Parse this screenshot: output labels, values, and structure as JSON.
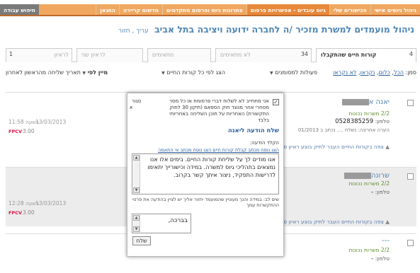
{
  "nav": {
    "tabs": [
      "ניהול גיוסים אישי",
      "הכישורים שלי",
      "גיוס עובדים - אפשרויות פרסום",
      "פתרונות גיוס ופרסום מתקדמים",
      "מדשום קריירה",
      "התגאן"
    ],
    "search_tab": "חיפוש עבודה"
  },
  "page": {
    "title": "ניהול מועמדים למשרת מזכיר /ה לחברה ידועה ויציבה בתל אביב",
    "edit_links": "עריך , חזור"
  },
  "filters": {
    "tabs": [
      {
        "count": "4",
        "label": "קורות חיים שהתקבלו",
        "active": true
      },
      {
        "count": "34",
        "label": "לא מתאימים"
      },
      {
        "count": "",
        "label": "מתאימים"
      },
      {
        "count": "",
        "label": "לראיון שני"
      },
      {
        "count": "1",
        "label": "לראיון"
      }
    ]
  },
  "toolbar": {
    "select_prefix": "סמן:",
    "select_options": [
      "הכל",
      "כלום",
      "נקראו",
      "לא נקראו"
    ],
    "actions_menu": "פעולות למסומנים",
    "show_cv": "הצג לפי כל קורות החיים",
    "sort": "מיין לפי",
    "sort_value": "תאריך שליחה מהראשון לאחרון"
  },
  "candidates": [
    {
      "name": "יאנה א",
      "experience": "2/2",
      "experience_label": "משרות נכונות",
      "phone_label": "טלפון:",
      "phone": "0528385259",
      "note": "הערה אחרונה: נשלח .... נכתב ב 01/2013",
      "date": "13/03/2013",
      "time": "בשעה 11:58",
      "price": "3.00",
      "actions": "צפה בקורות החיים  העבר לתיק  בוצע ראיון  סמן כלא נקרא"
    },
    {
      "name": "שרונה",
      "experience": "2/2",
      "experience_label": "משרות נכונות",
      "phone_label": "טלפון:",
      "phone": "-",
      "note": "",
      "date": "13/03/2013",
      "time": "בשעה 12:28",
      "price": "3.00",
      "actions": "צפה בקורות החיים  העבר לתיק  בוצע ראיון  סמן כנקרא"
    },
    {
      "name": "---",
      "experience": "2/2",
      "experience_label": "משרות נכונות",
      "phone_label": "טלפון:",
      "phone": "-",
      "note": "",
      "date": "",
      "time": "",
      "price": "",
      "actions": ""
    }
  ],
  "popup": {
    "consent": "אני מתחייב לא לשלוח דברי פרסומת או כל מסר מסחרי אחר מנוגד חוק הספאם (תיקון 30 לחוק התקשורת) האחריות על תוכן השליחה באחריותי בלבד",
    "close": "סגור",
    "close_x": "x",
    "title": "שלח הודעה ליאנה",
    "message_label": "הקלד הודעה:",
    "links": "הצג נוסח מכתב קבלת קורות חיים  הצג נוסח מכתב אי התאמה",
    "message": "אנו מודים לך על שליחת קורות החיים. בימים אלו אנו נמצאים בתהליכי גיוס למשרה. במידה וכישורייך יתאימו לדרישות התפקיד, ניצור איתך קשר בקרוב.",
    "hint": "שים לב: במידה והנך מעוניין שהמועמד יחזור אליך יש לציין בהודעה את פרטי ההתקשרות עמך",
    "signature": "בברכה,",
    "send": "שלח"
  }
}
